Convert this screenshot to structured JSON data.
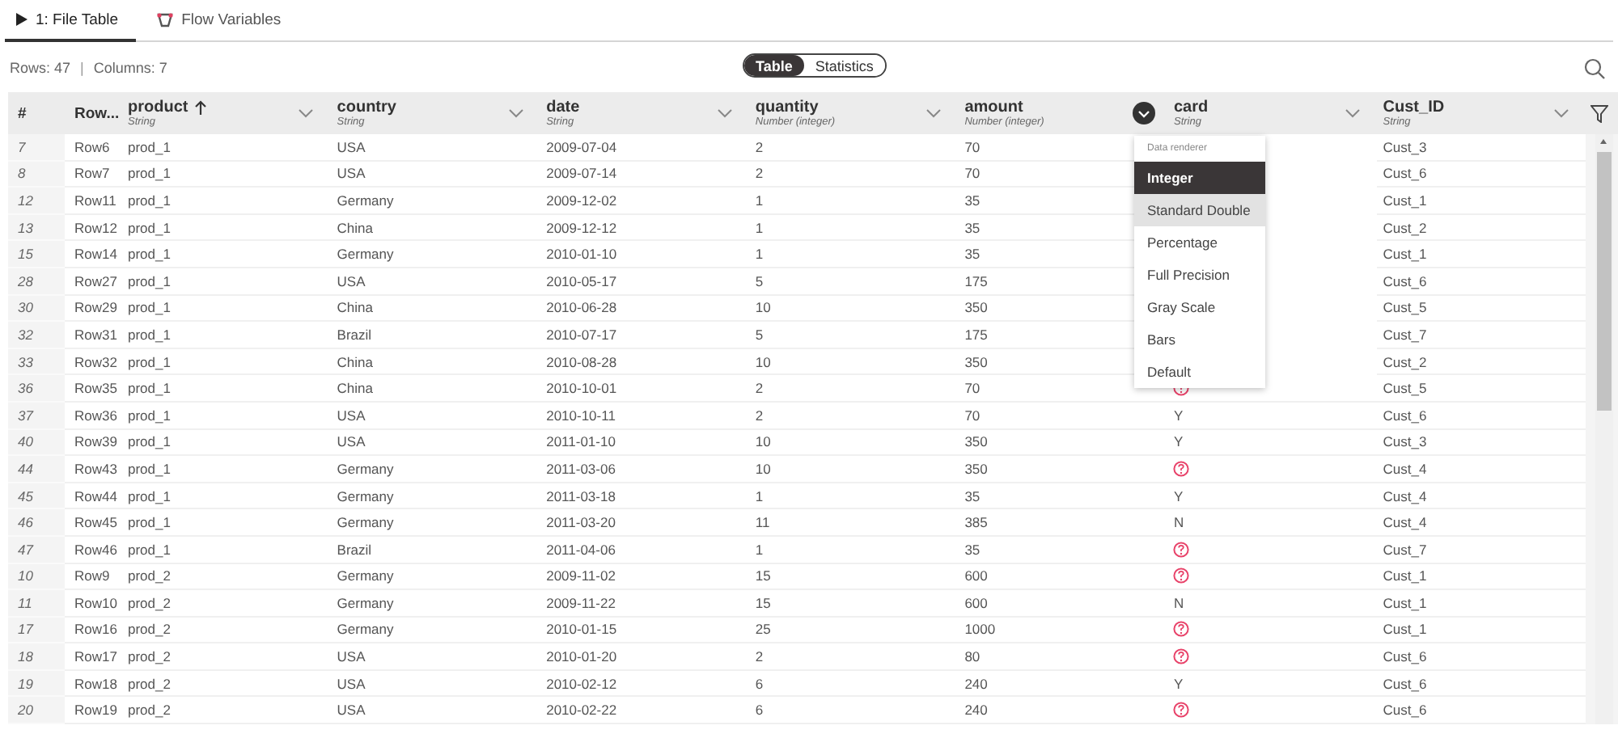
{
  "tabs": [
    {
      "label": "1: File Table",
      "kind": "play",
      "selected": true
    },
    {
      "label": "Flow Variables",
      "kind": "variables",
      "selected": false
    }
  ],
  "summary": {
    "rows": "Rows: 47",
    "separator": "|",
    "columns": "Columns: 7"
  },
  "view_toggle": [
    {
      "label": "Table",
      "selected": true
    },
    {
      "label": "Statistics",
      "selected": false
    }
  ],
  "table": {
    "index_header": "#",
    "rowid_header": "Row...",
    "columns": [
      {
        "name": "product",
        "type": "String",
        "sorted": true,
        "menu_open": false
      },
      {
        "name": "country",
        "type": "String",
        "sorted": false,
        "menu_open": false
      },
      {
        "name": "date",
        "type": "String",
        "sorted": false,
        "menu_open": false
      },
      {
        "name": "quantity",
        "type": "Number (integer)",
        "sorted": false,
        "menu_open": false
      },
      {
        "name": "amount",
        "type": "Number (integer)",
        "sorted": false,
        "menu_open": true
      },
      {
        "name": "card",
        "type": "String",
        "sorted": false,
        "menu_open": false
      },
      {
        "name": "Cust_ID",
        "type": "String",
        "sorted": false,
        "menu_open": false
      }
    ],
    "rows": [
      {
        "index": "7",
        "row_id": "Row6",
        "cells": [
          "prod_1",
          "USA",
          "2009-07-04",
          "2",
          "70"
        ],
        "cust_id": "Cust_3"
      },
      {
        "index": "8",
        "row_id": "Row7",
        "cells": [
          "prod_1",
          "USA",
          "2009-07-14",
          "2",
          "70"
        ],
        "cust_id": "Cust_6"
      },
      {
        "index": "12",
        "row_id": "Row11",
        "cells": [
          "prod_1",
          "Germany",
          "2009-12-02",
          "1",
          "35"
        ],
        "cust_id": "Cust_1"
      },
      {
        "index": "13",
        "row_id": "Row12",
        "cells": [
          "prod_1",
          "China",
          "2009-12-12",
          "1",
          "35"
        ],
        "cust_id": "Cust_2"
      },
      {
        "index": "15",
        "row_id": "Row14",
        "cells": [
          "prod_1",
          "Germany",
          "2010-01-10",
          "1",
          "35"
        ],
        "cust_id": "Cust_1"
      },
      {
        "index": "28",
        "row_id": "Row27",
        "cells": [
          "prod_1",
          "USA",
          "2010-05-17",
          "5",
          "175"
        ],
        "cust_id": "Cust_6"
      },
      {
        "index": "30",
        "row_id": "Row29",
        "cells": [
          "prod_1",
          "China",
          "2010-06-28",
          "10",
          "350"
        ],
        "cust_id": "Cust_5"
      },
      {
        "index": "32",
        "row_id": "Row31",
        "cells": [
          "prod_1",
          "Brazil",
          "2010-07-17",
          "5",
          "175"
        ],
        "cust_id": "Cust_7"
      },
      {
        "index": "33",
        "row_id": "Row32",
        "cells": [
          "prod_1",
          "China",
          "2010-08-28",
          "10",
          "350"
        ],
        "cust_id": "Cust_2"
      },
      {
        "index": "36",
        "row_id": "Row35",
        "cells": [
          "prod_1",
          "China",
          "2010-10-01",
          "2",
          "70"
        ],
        "card_missing": true,
        "cust_id": "Cust_5"
      },
      {
        "index": "37",
        "row_id": "Row36",
        "cells": [
          "prod_1",
          "USA",
          "2010-10-11",
          "2",
          "70"
        ],
        "card": "Y",
        "card_missing": false,
        "cust_id": "Cust_6"
      },
      {
        "index": "40",
        "row_id": "Row39",
        "cells": [
          "prod_1",
          "USA",
          "2011-01-10",
          "10",
          "350"
        ],
        "card": "Y",
        "card_missing": false,
        "cust_id": "Cust_3"
      },
      {
        "index": "44",
        "row_id": "Row43",
        "cells": [
          "prod_1",
          "Germany",
          "2011-03-06",
          "10",
          "350"
        ],
        "card_missing": true,
        "cust_id": "Cust_4"
      },
      {
        "index": "45",
        "row_id": "Row44",
        "cells": [
          "prod_1",
          "Germany",
          "2011-03-18",
          "1",
          "35"
        ],
        "card": "Y",
        "card_missing": false,
        "cust_id": "Cust_4"
      },
      {
        "index": "46",
        "row_id": "Row45",
        "cells": [
          "prod_1",
          "Germany",
          "2011-03-20",
          "11",
          "385"
        ],
        "card": "N",
        "card_missing": false,
        "cust_id": "Cust_4"
      },
      {
        "index": "47",
        "row_id": "Row46",
        "cells": [
          "prod_1",
          "Brazil",
          "2011-04-06",
          "1",
          "35"
        ],
        "card_missing": true,
        "cust_id": "Cust_7"
      },
      {
        "index": "10",
        "row_id": "Row9",
        "cells": [
          "prod_2",
          "Germany",
          "2009-11-02",
          "15",
          "600"
        ],
        "card_missing": true,
        "cust_id": "Cust_1"
      },
      {
        "index": "11",
        "row_id": "Row10",
        "cells": [
          "prod_2",
          "Germany",
          "2009-11-22",
          "15",
          "600"
        ],
        "card": "N",
        "card_missing": false,
        "cust_id": "Cust_1"
      },
      {
        "index": "17",
        "row_id": "Row16",
        "cells": [
          "prod_2",
          "Germany",
          "2010-01-15",
          "25",
          "1000"
        ],
        "card_missing": true,
        "cust_id": "Cust_1"
      },
      {
        "index": "18",
        "row_id": "Row17",
        "cells": [
          "prod_2",
          "USA",
          "2010-01-20",
          "2",
          "80"
        ],
        "card_missing": true,
        "cust_id": "Cust_6"
      },
      {
        "index": "19",
        "row_id": "Row18",
        "cells": [
          "prod_2",
          "USA",
          "2010-02-12",
          "6",
          "240"
        ],
        "card": "Y",
        "card_missing": false,
        "cust_id": "Cust_6"
      },
      {
        "index": "20",
        "row_id": "Row19",
        "cells": [
          "prod_2",
          "USA",
          "2010-02-22",
          "6",
          "240"
        ],
        "card_missing": true,
        "cust_id": "Cust_6"
      }
    ]
  },
  "renderer_menu": {
    "title": "Data renderer",
    "items": [
      {
        "label": "Integer",
        "selected": true,
        "highlighted": false
      },
      {
        "label": "Standard Double",
        "selected": false,
        "highlighted": true
      },
      {
        "label": "Percentage",
        "selected": false,
        "highlighted": false
      },
      {
        "label": "Full Precision",
        "selected": false,
        "highlighted": false
      },
      {
        "label": "Gray Scale",
        "selected": false,
        "highlighted": false
      },
      {
        "label": "Bars",
        "selected": false,
        "highlighted": false
      },
      {
        "label": "Default",
        "selected": false,
        "highlighted": false
      }
    ]
  }
}
